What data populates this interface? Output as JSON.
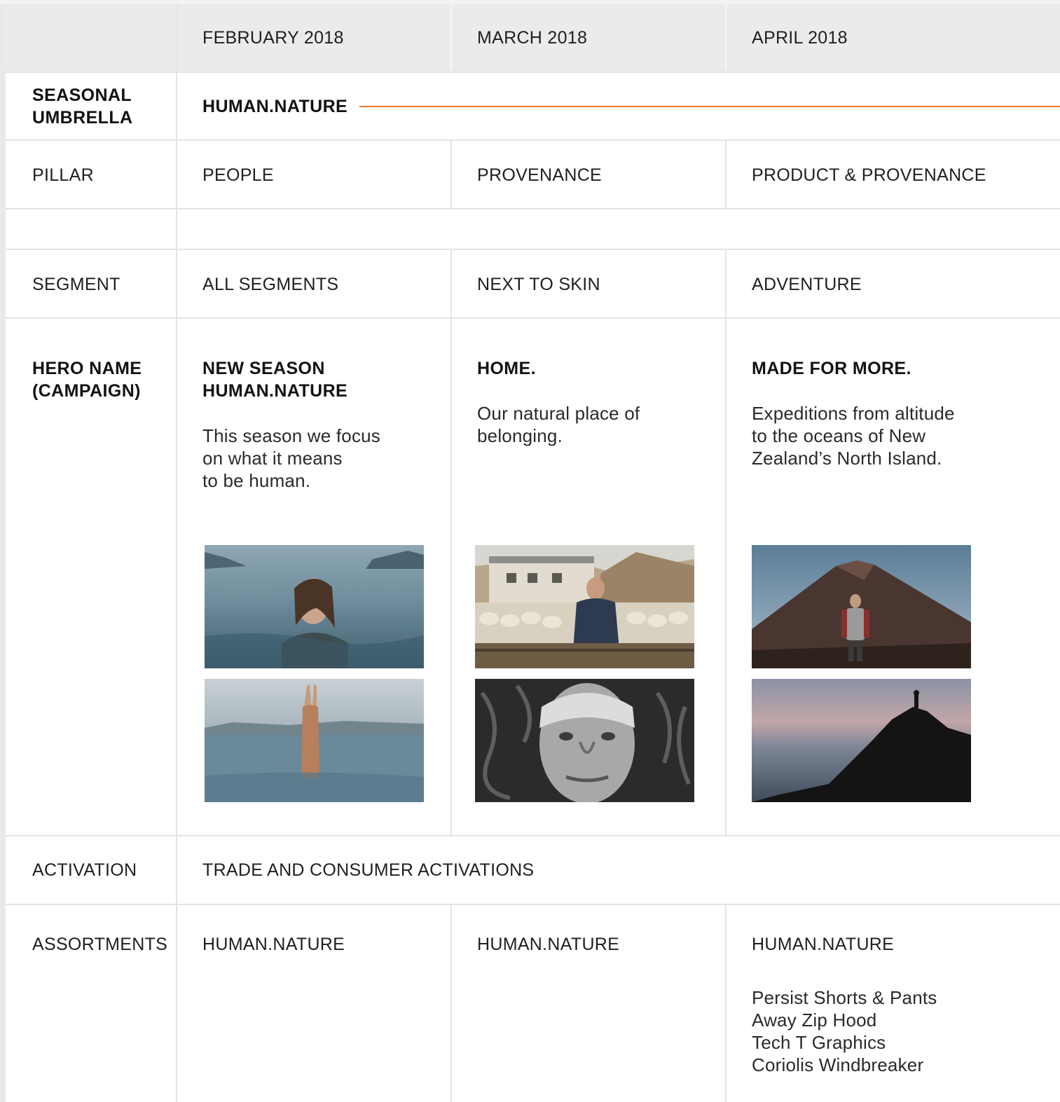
{
  "header": {
    "months": [
      "FEBRUARY 2018",
      "MARCH 2018",
      "APRIL 2018"
    ]
  },
  "rows": {
    "umbrella": {
      "label_line1": "SEASONAL",
      "label_line2": "UMBRELLA",
      "value": "HUMAN.NATURE"
    },
    "pillar": {
      "label": "PILLAR",
      "values": [
        "PEOPLE",
        "PROVENANCE",
        "PRODUCT & PROVENANCE"
      ]
    },
    "segment": {
      "label": "SEGMENT",
      "values": [
        "ALL SEGMENTS",
        "NEXT TO SKIN",
        "ADVENTURE"
      ]
    },
    "hero": {
      "label_line1": "HERO NAME",
      "label_line2": "(CAMPAIGN)",
      "campaigns": [
        {
          "title_line1": "NEW SEASON",
          "title_line2": "HUMAN.NATURE",
          "desc": [
            "This season we focus",
            "on what it means",
            "to be human."
          ],
          "images": [
            "woman-swimming-photo",
            "woman-arms-raised-photo"
          ]
        },
        {
          "title_line1": "HOME.",
          "title_line2": "",
          "desc": [
            "Our natural place of",
            "belonging."
          ],
          "images": [
            "farmer-with-sheep-photo",
            "elder-portrait-photo"
          ]
        },
        {
          "title_line1": "MADE FOR MORE.",
          "title_line2": "",
          "desc": [
            "Expeditions from altitude",
            "to the oceans of New",
            "Zealand’s North Island."
          ],
          "images": [
            "volcano-hiker-photo",
            "cliff-silhouette-photo"
          ]
        }
      ]
    },
    "activation": {
      "label": "ACTIVATION",
      "value": "TRADE AND CONSUMER ACTIVATIONS"
    },
    "assortments": {
      "label": "ASSORTMENTS",
      "values": [
        "HUMAN.NATURE",
        "HUMAN.NATURE",
        "HUMAN.NATURE"
      ],
      "april_items": [
        "Persist Shorts & Pants",
        "Away Zip Hood",
        "Tech T Graphics",
        "Coriolis Windbreaker"
      ]
    }
  },
  "colors": {
    "accent": "#e67a2e",
    "header_bg": "#ebebeb",
    "grid": "#e4e4e4"
  }
}
